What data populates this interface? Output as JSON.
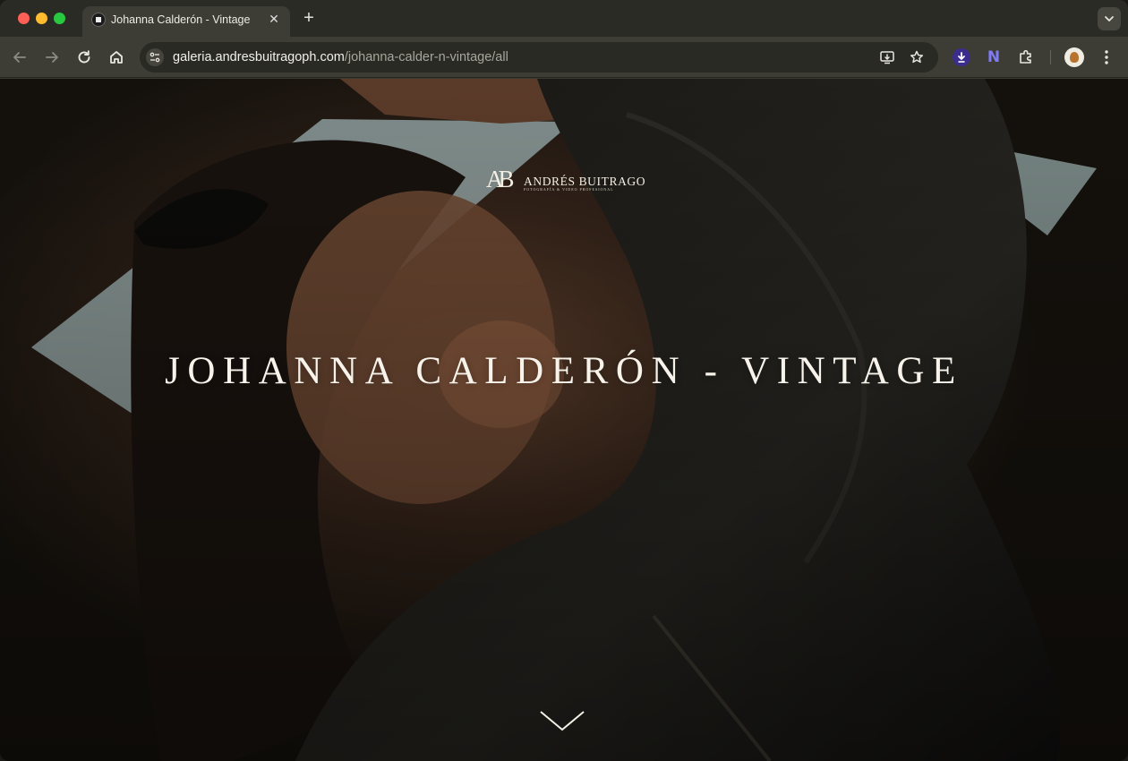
{
  "browser": {
    "tab": {
      "title": "Johanna Calderón - Vintage",
      "favicon": "gallery-favicon-icon"
    },
    "url": {
      "host": "galeria.andresbuitragoph.com",
      "path": "/johanna-calder-n-vintage/all"
    },
    "toolbar_icons": [
      "back-icon",
      "forward-icon",
      "reload-icon",
      "home-icon",
      "site-info-icon",
      "install-app-icon",
      "bookmark-star-icon",
      "download-extension-icon",
      "n-extension-icon",
      "extensions-puzzle-icon",
      "profile-avatar",
      "menu-dots-icon"
    ]
  },
  "page": {
    "logo": {
      "monogram": "AB",
      "name": "ANDRÉS BUITRAGO",
      "tagline": "FOTOGRAFÍA & VIDEO PROFESIONAL"
    },
    "title": "JOHANNA CALDERÓN - VINTAGE",
    "scroll_indicator": "chevron-down-icon"
  },
  "colors": {
    "tab_strip": "#2b2b26",
    "toolbar": "#3d3d35",
    "omnibox": "#2a2a24",
    "hero_text": "#f7f3ea"
  }
}
